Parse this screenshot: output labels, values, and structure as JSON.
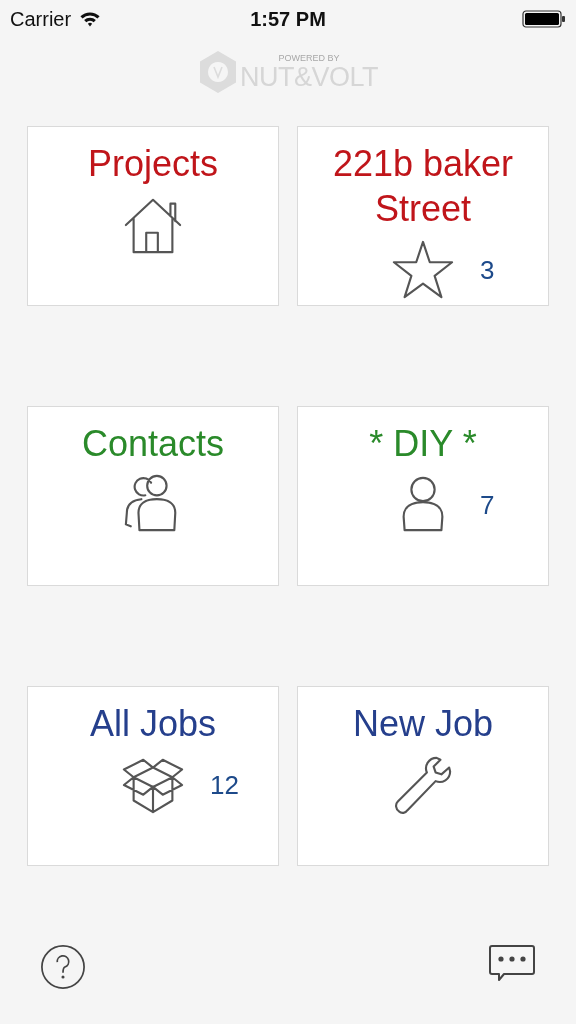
{
  "status_bar": {
    "carrier": "Carrier",
    "time": "1:57 PM"
  },
  "logo": {
    "tagline": "POWERED BY",
    "brand": "NUT&VOLT"
  },
  "tiles": [
    {
      "title": "Projects",
      "color": "#c0151a"
    },
    {
      "title": "221b baker Street",
      "color": "#c0151a",
      "count": "3"
    },
    {
      "title": "Contacts",
      "color": "#2a8a2a"
    },
    {
      "title": "* DIY *",
      "color": "#2a8a2a",
      "count": "7"
    },
    {
      "title": "All Jobs",
      "color": "#253f8c",
      "count": "12"
    },
    {
      "title": "New Job",
      "color": "#253f8c"
    }
  ]
}
